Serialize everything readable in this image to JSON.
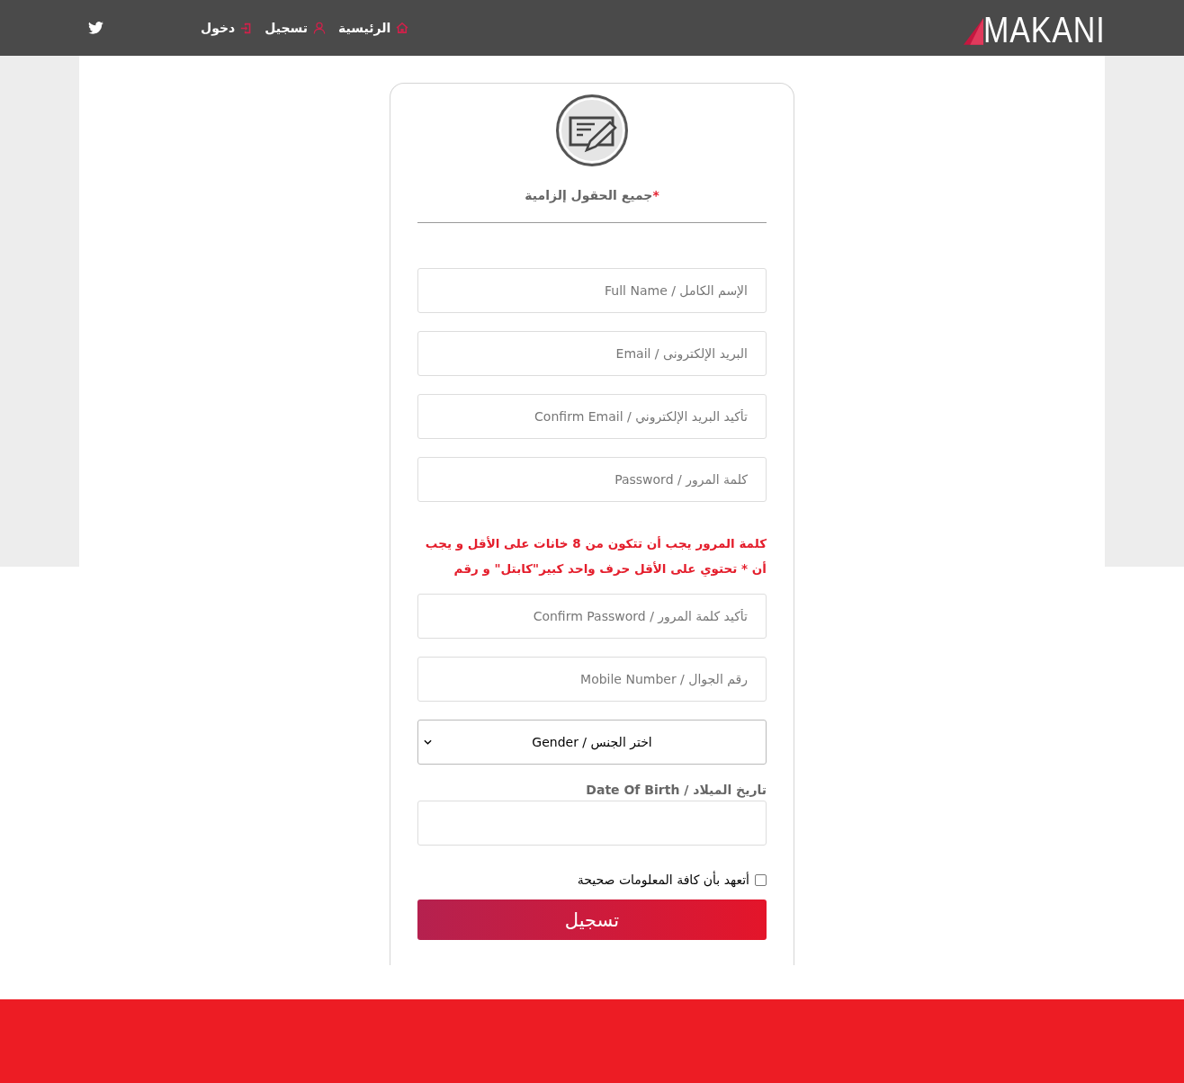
{
  "header": {
    "logo": "MAKANI",
    "nav": [
      {
        "kind": "home",
        "label": "الرئيسية"
      },
      {
        "kind": "user",
        "label": "تسجيل"
      },
      {
        "kind": "login",
        "label": "دخول"
      }
    ]
  },
  "form": {
    "required_mark": "*",
    "required_note": "جميع الحقول إلزامية",
    "fields": [
      {
        "kind": "input",
        "placeholder": "الإسم الكامل / Full Name"
      },
      {
        "kind": "input",
        "placeholder": "البريد الإلكترونى / Email"
      },
      {
        "kind": "input",
        "placeholder": "تأكيد البريد الإلكتروني / Confirm Email"
      },
      {
        "kind": "input",
        "placeholder": "كلمة المرور / Password"
      },
      {
        "kind": "note",
        "text": "كلمة المرور يجب أن تتكون من 8 خانات على الأقل و يجب أن * تحتوي على الأقل حرف واحد كبير\"كابتل\" و رقم"
      },
      {
        "kind": "input",
        "placeholder": "تأكيد كلمة المرور / Confirm Password"
      },
      {
        "kind": "input",
        "placeholder": "رقم الجوال / Mobile Number"
      },
      {
        "kind": "select",
        "value": "اختر الجنس / Gender"
      },
      {
        "kind": "label",
        "text": "تاريخ الميلاد / Date Of Birth"
      },
      {
        "kind": "input"
      }
    ],
    "agreement": {
      "label": "أتعهد بأن كافة المعلومات صحيحة",
      "checked": false
    },
    "submit": "تسجيل"
  }
}
